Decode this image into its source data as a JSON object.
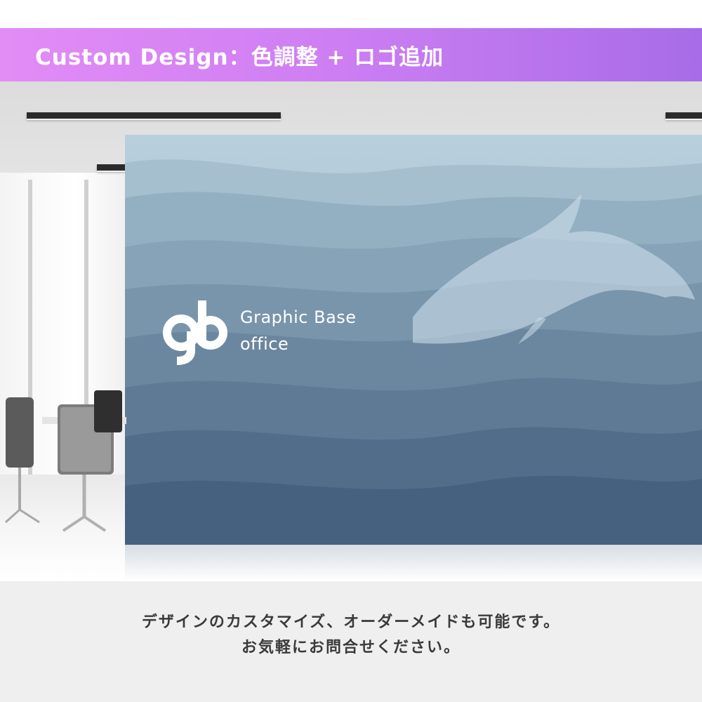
{
  "header": {
    "title": "Custom Design：色調整 + ロゴ追加"
  },
  "wall": {
    "brand_line1": "Graphic Base",
    "brand_line2": "office",
    "logo_icon": "gb-logo-icon",
    "illustration": "dolphin-silhouette"
  },
  "caption": {
    "line1": "デザインのカスタマイズ、オーダーメイドも可能です。",
    "line2": "お気軽にお問合せください。"
  },
  "colors": {
    "banner_start": "#e28cf6",
    "banner_end": "#a86ce8",
    "wall_top": "#a9c3d3",
    "wall_bottom": "#3f5a7a",
    "caption_text": "#3a3a3a"
  }
}
